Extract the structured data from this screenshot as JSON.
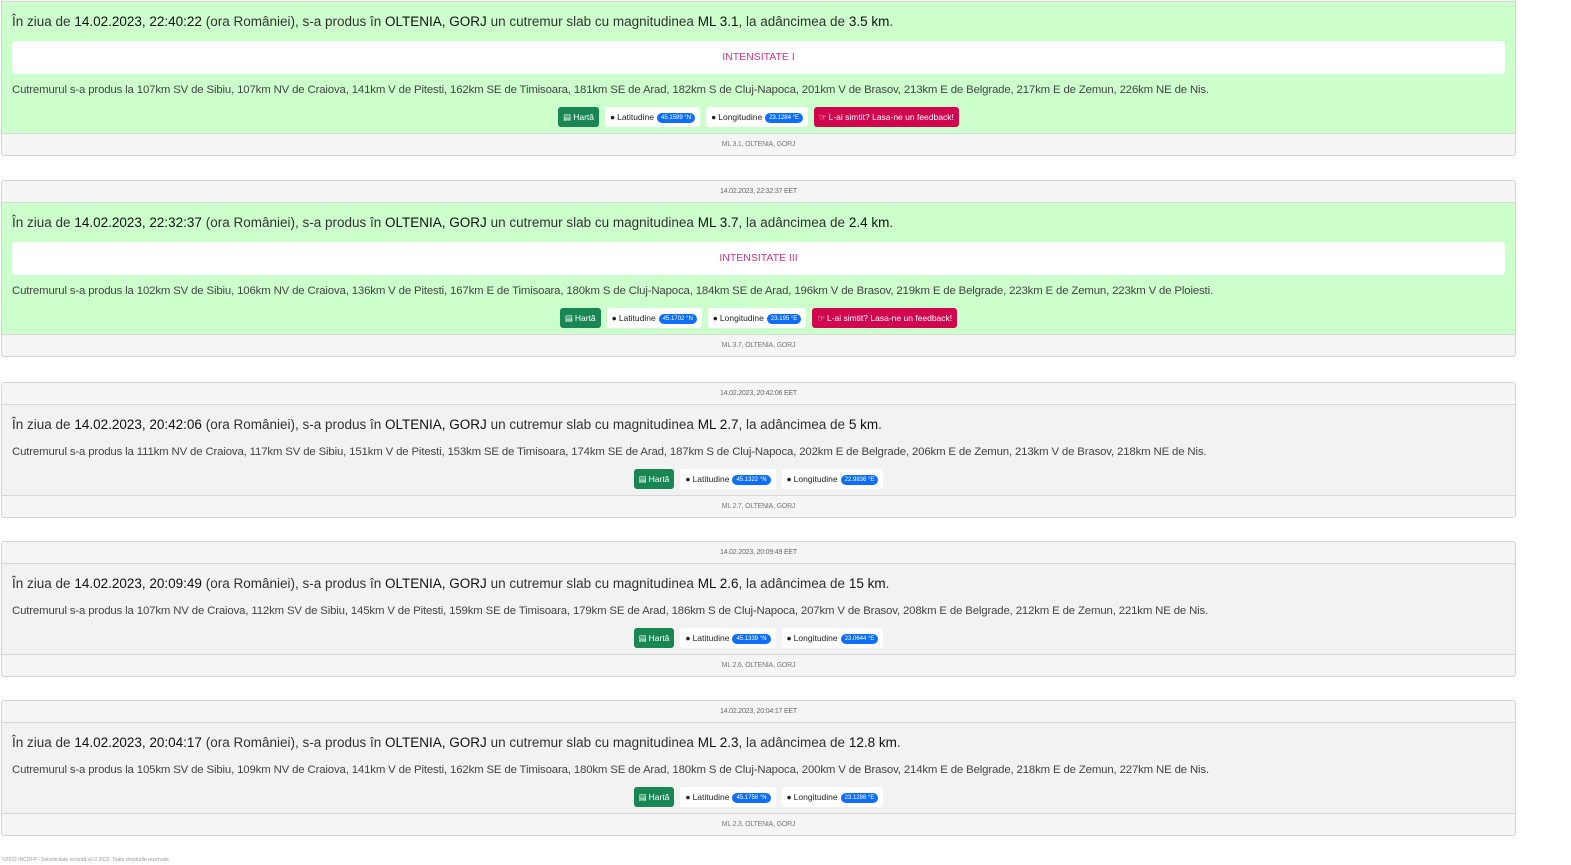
{
  "events": [
    {
      "header": "",
      "date": "14.02.2023, 22:40:22",
      "location": "OLTENIA, GORJ",
      "magnitude": "ML 3.1",
      "depth": "3.5 km",
      "intensity": "INTENSITATE I",
      "nearby": "Cutremurul s-a produs la 107km SV de Sibiu, 107km NV de Craiova, 141km V de Pitesti, 162km SE de Timisoara, 181km SE de Arad, 182km S de Cluj-Napoca, 201km V de Brasov, 213km E de Belgrade, 217km E de Zemun, 226km NE de Nis.",
      "lat": "45.1599 °N",
      "lon": "23.1284 °E",
      "footer": "ML 3.1, OLTENIA, GORJ",
      "bg": "green"
    },
    {
      "header": "14.02.2023, 22:32:37 EET",
      "date": "14.02.2023, 22:32:37",
      "location": "OLTENIA, GORJ",
      "magnitude": "ML 3.7",
      "depth": "2.4 km",
      "intensity": "INTENSITATE III",
      "nearby": "Cutremurul s-a produs la 102km SV de Sibiu, 106km NV de Craiova, 136km V de Pitesti, 167km E de Timisoara, 180km S de Cluj-Napoca, 184km SE de Arad, 196km V de Brasov, 219km E de Belgrade, 223km E de Zemun, 223km V de Ploiesti.",
      "lat": "45.1702 °N",
      "lon": "23.195 °E",
      "footer": "ML 3.7, OLTENIA, GORJ",
      "bg": "green"
    },
    {
      "header": "14.02.2023, 20:42:06 EET",
      "date": "14.02.2023, 20:42:06",
      "location": "OLTENIA, GORJ",
      "magnitude": "ML 2.7",
      "depth": "5 km",
      "intensity": "",
      "nearby": "Cutremurul s-a produs la 111km NV de Craiova, 117km SV de Sibiu, 151km V de Pitesti, 153km SE de Timisoara, 174km SE de Arad, 187km S de Cluj-Napoca, 202km E de Belgrade, 206km E de Zemun, 213km V de Brasov, 218km NE de Nis.",
      "lat": "45.1322 °N",
      "lon": "22.9836 °E",
      "footer": "ML 2.7, OLTENIA, GORJ",
      "bg": "grey"
    },
    {
      "header": "14.02.2023, 20:09:49 EET",
      "date": "14.02.2023, 20:09:49",
      "location": "OLTENIA, GORJ",
      "magnitude": "ML 2.6",
      "depth": "15 km",
      "intensity": "",
      "nearby": "Cutremurul s-a produs la 107km NV de Craiova, 112km SV de Sibiu, 145km V de Pitesti, 159km SE de Timisoara, 179km SE de Arad, 186km S de Cluj-Napoca, 207km V de Brasov, 208km E de Belgrade, 212km E de Zemun, 221km NE de Nis.",
      "lat": "45.1339 °N",
      "lon": "23.0644 °E",
      "footer": "ML 2.6, OLTENIA, GORJ",
      "bg": "grey"
    },
    {
      "header": "14.02.2023, 20:04:17 EET",
      "date": "14.02.2023, 20:04:17",
      "location": "OLTENIA, GORJ",
      "magnitude": "ML 2.3",
      "depth": "12.8 km",
      "intensity": "",
      "nearby": "Cutremurul s-a produs la 105km SV de Sibiu, 109km NV de Craiova, 141km V de Pitesti, 162km SE de Timisoara, 180km SE de Arad, 180km S de Cluj-Napoca, 200km V de Brasov, 214km E de Belgrade, 218km E de Zemun, 227km NE de Nis.",
      "lat": "45.1758 °N",
      "lon": "23.1286 °E",
      "footer": "ML 2.3, OLTENIA, GORJ",
      "bg": "grey"
    }
  ],
  "labels": {
    "intro": "În ziua de",
    "ora": "(ora României), s-a produs în",
    "cutremur": "un cutremur slab cu magnitudinea",
    "adancime": ", la adâncimea de",
    "map": "Hartă",
    "latitude": "Latitudine",
    "longitude": "Longitudine",
    "feedback": "L-ai simtit? Lasa-ne un feedback!"
  },
  "icons": {
    "map": "map-icon",
    "pin": "map-marker-icon",
    "hand": "hand-point-icon"
  },
  "colors": {
    "felt_bg": "#ccffcc",
    "default_bg": "#f2f2f2",
    "intensity_text": "#d63384",
    "map_button": "#198754",
    "feedback_button": "#d1064f",
    "coord_badge": "#0d6efd"
  },
  "footer_note": "©2022 INCDFP - Seismicitate recentă v2.0 2022. Toate drepturile rezervate."
}
